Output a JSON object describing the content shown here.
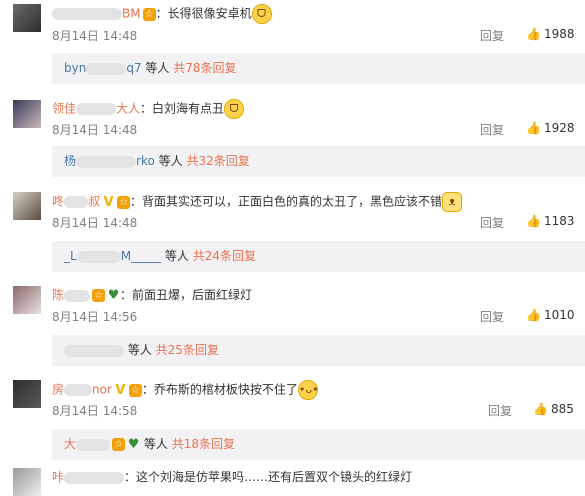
{
  "comments": [
    {
      "user_visible": "BM",
      "text": "：长得很像安卓机",
      "date": "8月14日 14:48",
      "reply": "回复",
      "likes": "1988",
      "sub_user": "byn",
      "sub_user_tail": "q7",
      "sub_suffix": "等人",
      "sub_more": "共78条回复"
    },
    {
      "user_visible": "领佳",
      "user_tail": "大人",
      "text": "：白刘海有点丑",
      "date": "8月14日 14:48",
      "reply": "回复",
      "likes": "1928",
      "sub_user": "杨",
      "sub_user_tail": "rko",
      "sub_suffix": "等人",
      "sub_more": "共32条回复"
    },
    {
      "user_visible": "咚",
      "user_tail": "叔",
      "text": "：背面其实还可以，正面白色的真的太丑了，黑色应该不错",
      "date": "8月14日 14:48",
      "reply": "回复",
      "likes": "1183",
      "sub_user": "_L",
      "sub_user_tail": "M_____",
      "sub_suffix": "等人",
      "sub_more": "共24条回复"
    },
    {
      "user_visible": "陈",
      "text": "：前面丑爆，后面红绿灯",
      "date": "8月14日 14:56",
      "reply": "回复",
      "likes": "1010",
      "sub_user": "",
      "sub_user_tail": "",
      "sub_suffix": "等人",
      "sub_more": "共25条回复"
    },
    {
      "user_visible": "房",
      "user_tail": "nor",
      "text": "：乔布斯的棺材板快按不住了",
      "date": "8月14日 14:58",
      "reply": "回复",
      "likes": "885",
      "sub_user": "大",
      "sub_user_tail": "",
      "sub_suffix": "等人",
      "sub_more": "共18条回复"
    }
  ],
  "last_comment": {
    "user_visible": "咔",
    "text": "：这个刘海是仿苹果吗……还有后置双个镜头的红绿灯",
    "emoji": "😐"
  },
  "icons": {
    "thumb": "thumb-up-icon",
    "emoji_laugh": "laughing-emoji",
    "emoji_cat": "cat-emoji",
    "emoji_sweat": "sweat-emoji"
  },
  "colors": {
    "link": "#eb7350",
    "subbar_bg": "#f2f2f5",
    "meta": "#808080"
  }
}
